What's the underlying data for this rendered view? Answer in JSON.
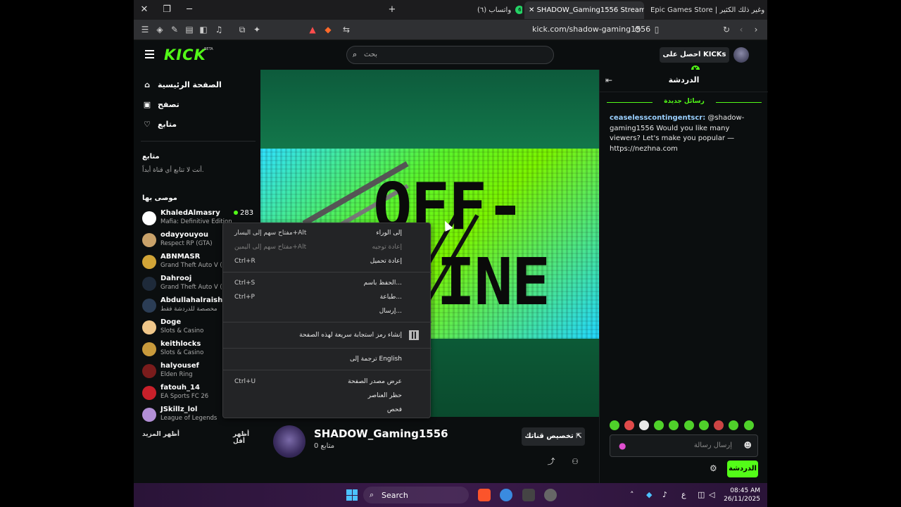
{
  "browser": {
    "tabs": [
      {
        "label": "Epic Games Store | بل وغير ذلك الكثير"
      },
      {
        "label": "SHADOW_Gaming1556 Stream -"
      },
      {
        "label": "(٦) واتساب",
        "badge": "6"
      }
    ],
    "url": "kick.com/shadow-gaming1556"
  },
  "header": {
    "logo": "KICK",
    "logo_badge": "BETA",
    "search_placeholder": "بحث",
    "get_kicks_label": "احصل على KICKs"
  },
  "sidebar": {
    "nav": [
      {
        "label": "الصفحة الرئيسية",
        "icon": "home-icon"
      },
      {
        "label": "تصفح",
        "icon": "browse-icon"
      },
      {
        "label": "متابع",
        "icon": "heart-icon"
      }
    ],
    "following_title": "متابع",
    "following_empty": "أنت لا تتابع أي قناة أبداً.",
    "recommended_title": "موصى بها",
    "recommended": [
      {
        "name": "KhaledAlmasry",
        "game": "Mafia: Definitive Edition",
        "viewers": "283",
        "color": "#ffffff"
      },
      {
        "name": "odayyouyou",
        "game": "Respect RP (GTA)",
        "color": "#c9a26a"
      },
      {
        "name": "ABNMASR",
        "game": "Grand Theft Auto V (G",
        "color": "#d1a437"
      },
      {
        "name": "Dahrooj",
        "game": "Grand Theft Auto V (G",
        "color": "#1e2a3a"
      },
      {
        "name": "Abdullahalraish",
        "game": "مخصصة للدردشة فقط",
        "color": "#2b3d55"
      },
      {
        "name": "Doge",
        "game": "Slots & Casino",
        "color": "#f0c78a"
      },
      {
        "name": "keithlocks",
        "game": "Slots & Casino",
        "color": "#c89a3c"
      },
      {
        "name": "halyousef",
        "game": "Elden Ring",
        "color": "#7a1c1c"
      },
      {
        "name": "fatouh_14",
        "game": "EA Sports FC 26",
        "color": "#c8202a"
      },
      {
        "name": "JSkillz_lol",
        "game": "League of Legends",
        "color": "#b28fd6"
      }
    ],
    "show_more": "أظهر المزيد",
    "show_less": "أظهر أقل"
  },
  "channel": {
    "name": "SHADOW_Gaming1556",
    "followers": "0 متابع",
    "customize_label": "تخصيص قناتك",
    "offline_line1": "OFF-",
    "offline_line2": "INE"
  },
  "chat": {
    "title": "الدردشة",
    "new_messages": "رسائل جديدة",
    "messages": [
      {
        "user": "ceaselesscontingentscr:",
        "text": "@shadow-gaming1556 Would you like many viewers? Let's make you popular — https://nezhna.com"
      }
    ],
    "input_placeholder": "إرسال رسالة",
    "send_label": "الدردشة"
  },
  "context_menu": {
    "items": [
      {
        "label": "إلى الوراء",
        "shortcut": "مفتاح سهم إلى اليسار+Alt",
        "disabled": false
      },
      {
        "label": "إعادة توجيه",
        "shortcut": "مفتاح سهم إلى اليمين+Alt",
        "disabled": true
      },
      {
        "label": "إعادة تحميل",
        "shortcut": "Ctrl+R",
        "disabled": false
      },
      {
        "label": "الحفظ باسم...",
        "shortcut": "Ctrl+S",
        "disabled": false
      },
      {
        "label": "طباعة...",
        "shortcut": "Ctrl+P",
        "disabled": false
      },
      {
        "label": "إرسال...",
        "shortcut": "",
        "disabled": false
      },
      {
        "label": "إنشاء رمز استجابة سريعة لهذه الصفحة",
        "shortcut": "",
        "disabled": false
      },
      {
        "label": "ترجمة إلى English",
        "shortcut": "",
        "disabled": false
      },
      {
        "label": "عرض مصدر الصفحة",
        "shortcut": "Ctrl+U",
        "disabled": false
      },
      {
        "label": "حظر العناصر",
        "shortcut": "",
        "disabled": false
      },
      {
        "label": "فحص",
        "shortcut": "",
        "disabled": false
      }
    ]
  },
  "taskbar": {
    "search_label": "Search",
    "time": "08:45 AM",
    "date": "26/11/2025",
    "lang": "ع"
  }
}
